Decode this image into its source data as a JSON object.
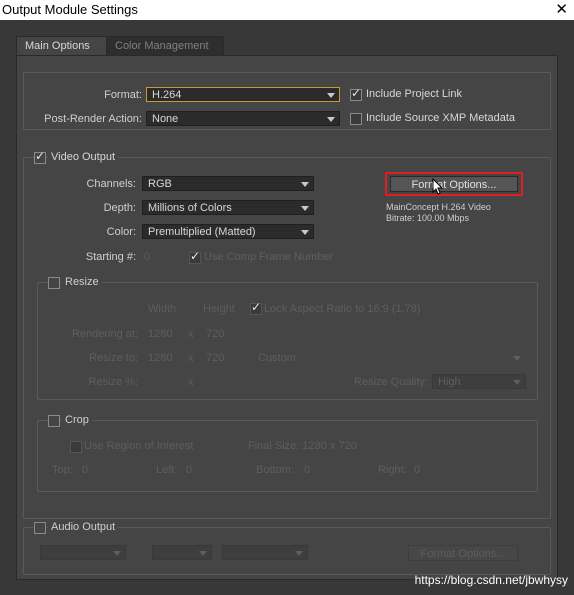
{
  "window": {
    "title": "Output Module Settings",
    "close_glyph": "✕"
  },
  "tabs": [
    {
      "label": "Main Options",
      "active": true
    },
    {
      "label": "Color Management",
      "active": false
    }
  ],
  "format": {
    "format_label": "Format:",
    "format_value": "H.264",
    "post_render_label": "Post-Render Action:",
    "post_render_value": "None",
    "include_project_link": "Include Project Link",
    "include_source_xmp": "Include Source XMP Metadata"
  },
  "video": {
    "section_label": "Video Output",
    "channels_label": "Channels:",
    "channels_value": "RGB",
    "depth_label": "Depth:",
    "depth_value": "Millions of Colors",
    "color_label": "Color:",
    "color_value": "Premultiplied (Matted)",
    "starting_label": "Starting #:",
    "starting_value": "0",
    "use_comp_frame": "Use Comp Frame Number",
    "format_options_button": "Format Options...",
    "codec_info_line1": "MainConcept H.264 Video",
    "codec_info_line2": "Bitrate: 100.00 Mbps"
  },
  "resize": {
    "section_label": "Resize",
    "width_header": "Width",
    "height_header": "Height",
    "lock_aspect": "Lock Aspect Ratio to 16:9 (1.78)",
    "rendering_label": "Rendering at:",
    "rendering_w": "1280",
    "rendering_x": "x",
    "rendering_h": "720",
    "resize_to_label": "Resize to:",
    "resize_to_w": "1280",
    "resize_to_x": "x",
    "resize_to_h": "720",
    "resize_preset": "Custom",
    "resize_pct_label": "Resize %:",
    "resize_pct_x": "x",
    "resize_quality_label": "Resize Quality:",
    "resize_quality_value": "High"
  },
  "crop": {
    "section_label": "Crop",
    "use_roi": "Use Region of Interest",
    "final_size": "Final Size: 1280 x 720",
    "top_label": "Top:",
    "top_value": "0",
    "left_label": "Left:",
    "left_value": "0",
    "bottom_label": "Bottom:",
    "bottom_value": "0",
    "right_label": "Right:",
    "right_value": "0"
  },
  "audio": {
    "section_label": "Audio Output",
    "format_options_button": "Format Options..."
  },
  "watermark": "https://blog.csdn.net/jbwhysy",
  "colors": {
    "panel_bg": "#454545",
    "highlight_border": "#c99a2e",
    "annotation_red": "#e02020"
  }
}
